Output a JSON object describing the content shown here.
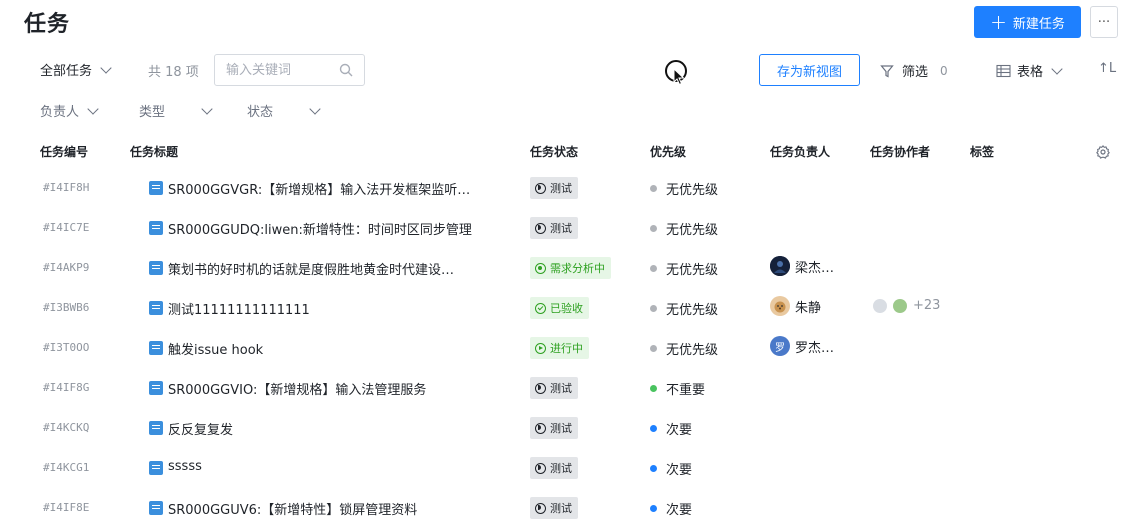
{
  "page": {
    "title": "任务"
  },
  "header": {
    "new_button": "新建任务",
    "more": "···"
  },
  "toolbar": {
    "view": "全部任务",
    "count": "共 18 项",
    "search_placeholder": "输入关键词",
    "save_view": "存为新视图",
    "filter_label": "筛选",
    "filter_count": "0",
    "layout_label": "表格",
    "sort_label": "↑L"
  },
  "filters": [
    "负责人",
    "类型",
    "状态"
  ],
  "columns": {
    "id": "任务编号",
    "title": "任务标题",
    "status": "任务状态",
    "priority": "优先级",
    "assignee": "任务负责人",
    "collaborators": "任务协作者",
    "tags": "标签"
  },
  "colors": {
    "accent": "#1e80ff",
    "status_green": "#2ea121",
    "priority_none": "#b0b3b8",
    "priority_low": "#49c35f",
    "priority_minor": "#1e80ff"
  },
  "rows": [
    {
      "id": "#I4IF8H",
      "title": "SR000GGVGR:【新增规格】输入法开发框架监听…",
      "status": "测试",
      "priority": "无优先级",
      "assignee": "",
      "collab": ""
    },
    {
      "id": "#I4IC7E",
      "title": "SR000GGUDQ:liwen:新增特性：时间时区同步管理",
      "status": "测试",
      "priority": "无优先级",
      "assignee": "",
      "collab": ""
    },
    {
      "id": "#I4AKP9",
      "title": "策划书的好时机的话就是度假胜地黄金时代建设…",
      "status": "需求分析中",
      "priority": "无优先级",
      "assignee": "梁杰…",
      "collab": ""
    },
    {
      "id": "#I3BWB6",
      "title": "测试11111111111111",
      "status": "已验收",
      "priority": "无优先级",
      "assignee": "朱静",
      "collab": "+23"
    },
    {
      "id": "#I3T0OO",
      "title": "触发issue hook",
      "status": "进行中",
      "priority": "无优先级",
      "assignee": "罗杰…",
      "avatar_letter": "罗",
      "collab": ""
    },
    {
      "id": "#I4IF8G",
      "title": "SR000GGVIO:【新增规格】输入法管理服务",
      "status": "测试",
      "priority": "不重要",
      "assignee": "",
      "collab": ""
    },
    {
      "id": "#I4KCKQ",
      "title": "反反复复发",
      "status": "测试",
      "priority": "次要",
      "assignee": "",
      "collab": ""
    },
    {
      "id": "#I4KCG1",
      "title": "sssss",
      "status": "测试",
      "priority": "次要",
      "assignee": "",
      "collab": ""
    },
    {
      "id": "#I4IF8E",
      "title": "SR000GGUV6:【新增特性】锁屏管理资料",
      "status": "测试",
      "priority": "次要",
      "assignee": "",
      "collab": ""
    }
  ]
}
